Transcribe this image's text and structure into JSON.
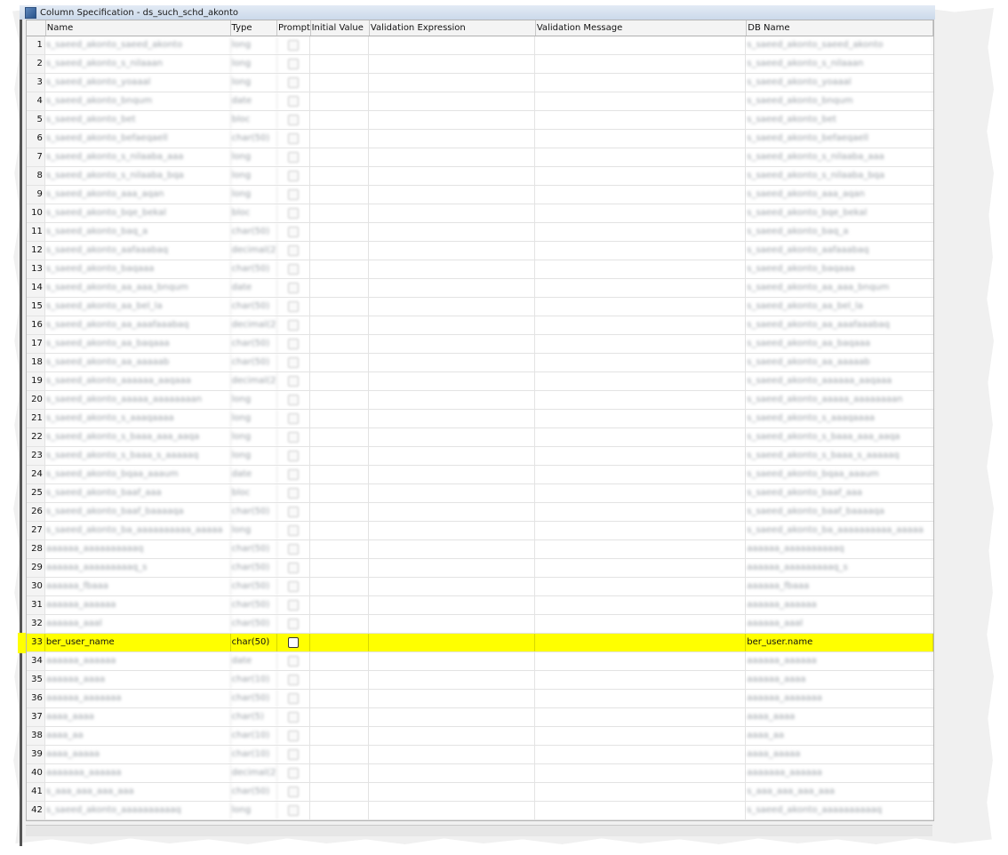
{
  "window": {
    "title": "Column Specification - ds_such_schd_akonto"
  },
  "columns": [
    "Name",
    "Type",
    "Prompt",
    "Initial Value",
    "Validation Expression",
    "Validation Message",
    "DB Name"
  ],
  "rows": [
    {
      "num": "1",
      "name": "s_saeed_akonto_saeed_akonto",
      "type": "long",
      "db": "s_saeed_akonto_saeed_akonto",
      "highlight": false
    },
    {
      "num": "2",
      "name": "s_saeed_akonto_s_nilaaan",
      "type": "long",
      "db": "s_saeed_akonto_s_nilaaan",
      "highlight": false
    },
    {
      "num": "3",
      "name": "s_saeed_akonto_yoaaal",
      "type": "long",
      "db": "s_saeed_akonto_yoaaal",
      "highlight": false
    },
    {
      "num": "4",
      "name": "s_saeed_akonto_bnqum",
      "type": "date",
      "db": "s_saeed_akonto_bnqum",
      "highlight": false
    },
    {
      "num": "5",
      "name": "s_saeed_akonto_bet",
      "type": "bloc",
      "db": "s_saeed_akonto_bet",
      "highlight": false
    },
    {
      "num": "6",
      "name": "s_saeed_akonto_befaeqaell",
      "type": "char(50)",
      "db": "s_saeed_akonto_befaeqaell",
      "highlight": false
    },
    {
      "num": "7",
      "name": "s_saeed_akonto_s_nilaaba_aaa",
      "type": "long",
      "db": "s_saeed_akonto_s_nilaaba_aaa",
      "highlight": false
    },
    {
      "num": "8",
      "name": "s_saeed_akonto_s_nilaaba_bqa",
      "type": "long",
      "db": "s_saeed_akonto_s_nilaaba_bqa",
      "highlight": false
    },
    {
      "num": "9",
      "name": "s_saeed_akonto_aaa_aqan",
      "type": "long",
      "db": "s_saeed_akonto_aaa_aqan",
      "highlight": false
    },
    {
      "num": "10",
      "name": "s_saeed_akonto_bqe_bekal",
      "type": "bloc",
      "db": "s_saeed_akonto_bqe_bekal",
      "highlight": false
    },
    {
      "num": "11",
      "name": "s_saeed_akonto_baq_a",
      "type": "char(50)",
      "db": "s_saeed_akonto_baq_a",
      "highlight": false
    },
    {
      "num": "12",
      "name": "s_saeed_akonto_aafaaabaq",
      "type": "decimal(2)",
      "db": "s_saeed_akonto_aafaaabaq",
      "highlight": false
    },
    {
      "num": "13",
      "name": "s_saeed_akonto_baqaaa",
      "type": "char(50)",
      "db": "s_saeed_akonto_baqaaa",
      "highlight": false
    },
    {
      "num": "14",
      "name": "s_saeed_akonto_aa_aaa_bnqum",
      "type": "date",
      "db": "s_saeed_akonto_aa_aaa_bnqum",
      "highlight": false
    },
    {
      "num": "15",
      "name": "s_saeed_akonto_aa_bel_la",
      "type": "char(50)",
      "db": "s_saeed_akonto_aa_bel_la",
      "highlight": false
    },
    {
      "num": "16",
      "name": "s_saeed_akonto_aa_aaafaaabaq",
      "type": "decimal(2)",
      "db": "s_saeed_akonto_aa_aaafaaabaq",
      "highlight": false
    },
    {
      "num": "17",
      "name": "s_saeed_akonto_aa_baqaaa",
      "type": "char(50)",
      "db": "s_saeed_akonto_aa_baqaaa",
      "highlight": false
    },
    {
      "num": "18",
      "name": "s_saeed_akonto_aa_aaaaab",
      "type": "char(50)",
      "db": "s_saeed_akonto_aa_aaaaab",
      "highlight": false
    },
    {
      "num": "19",
      "name": "s_saeed_akonto_aaaaaa_aaqaaa",
      "type": "decimal(2)",
      "db": "s_saeed_akonto_aaaaaa_aaqaaa",
      "highlight": false
    },
    {
      "num": "20",
      "name": "s_saeed_akonto_aaaaa_aaaaaaaan",
      "type": "long",
      "db": "s_saeed_akonto_aaaaa_aaaaaaaan",
      "highlight": false
    },
    {
      "num": "21",
      "name": "s_saeed_akonto_s_aaaqaaaa",
      "type": "long",
      "db": "s_saeed_akonto_s_aaaqaaaa",
      "highlight": false
    },
    {
      "num": "22",
      "name": "s_saeed_akonto_s_baaa_aaa_aaqa",
      "type": "long",
      "db": "s_saeed_akonto_s_baaa_aaa_aaqa",
      "highlight": false
    },
    {
      "num": "23",
      "name": "s_saeed_akonto_s_baaa_s_aaaaaq",
      "type": "long",
      "db": "s_saeed_akonto_s_baaa_s_aaaaaq",
      "highlight": false
    },
    {
      "num": "24",
      "name": "s_saeed_akonto_bqaa_aaaum",
      "type": "date",
      "db": "s_saeed_akonto_bqaa_aaaum",
      "highlight": false
    },
    {
      "num": "25",
      "name": "s_saeed_akonto_baaf_aaa",
      "type": "bloc",
      "db": "s_saeed_akonto_baaf_aaa",
      "highlight": false
    },
    {
      "num": "26",
      "name": "s_saeed_akonto_baaf_baaaaqa",
      "type": "char(50)",
      "db": "s_saeed_akonto_baaf_baaaaqa",
      "highlight": false
    },
    {
      "num": "27",
      "name": "s_saeed_akonto_ba_aaaaaaaaaa_aaaaa",
      "type": "long",
      "db": "s_saeed_akonto_ba_aaaaaaaaaa_aaaaa",
      "highlight": false
    },
    {
      "num": "28",
      "name": "aaaaaa_aaaaaaaaaaq",
      "type": "char(50)",
      "db": "aaaaaa_aaaaaaaaaaq",
      "highlight": false
    },
    {
      "num": "29",
      "name": "aaaaaa_aaaaaaaaaq_s",
      "type": "char(50)",
      "db": "aaaaaa_aaaaaaaaaq_s",
      "highlight": false
    },
    {
      "num": "30",
      "name": "aaaaaa_fbaaa",
      "type": "char(50)",
      "db": "aaaaaa_fbaaa",
      "highlight": false
    },
    {
      "num": "31",
      "name": "aaaaaa_aaaaaa",
      "type": "char(50)",
      "db": "aaaaaa_aaaaaa",
      "highlight": false
    },
    {
      "num": "32",
      "name": "aaaaaa_aaal",
      "type": "char(50)",
      "db": "aaaaaa_aaal",
      "highlight": false
    },
    {
      "num": "33",
      "name": "ber_user_name",
      "type": "char(50)",
      "db": "ber_user.name",
      "highlight": true
    },
    {
      "num": "34",
      "name": "aaaaaa_aaaaaa",
      "type": "date",
      "db": "aaaaaa_aaaaaa",
      "highlight": false
    },
    {
      "num": "35",
      "name": "aaaaaa_aaaa",
      "type": "char(10)",
      "db": "aaaaaa_aaaa",
      "highlight": false
    },
    {
      "num": "36",
      "name": "aaaaaa_aaaaaaa",
      "type": "char(50)",
      "db": "aaaaaa_aaaaaaa",
      "highlight": false
    },
    {
      "num": "37",
      "name": "aaaa_aaaa",
      "type": "char(5)",
      "db": "aaaa_aaaa",
      "highlight": false
    },
    {
      "num": "38",
      "name": "aaaa_aa",
      "type": "char(10)",
      "db": "aaaa_aa",
      "highlight": false
    },
    {
      "num": "39",
      "name": "aaaa_aaaaa",
      "type": "char(10)",
      "db": "aaaa_aaaaa",
      "highlight": false
    },
    {
      "num": "40",
      "name": "aaaaaaa_aaaaaa",
      "type": "decimal(2)",
      "db": "aaaaaaa_aaaaaa",
      "highlight": false
    },
    {
      "num": "41",
      "name": "s_aaa_aaa_aaa_aaa",
      "type": "char(50)",
      "db": "s_aaa_aaa_aaa_aaa",
      "highlight": false
    },
    {
      "num": "42",
      "name": "s_saeed_akonto_aaaaaaaaaaq",
      "type": "long",
      "db": "s_saeed_akonto_aaaaaaaaaaq",
      "highlight": false
    }
  ]
}
